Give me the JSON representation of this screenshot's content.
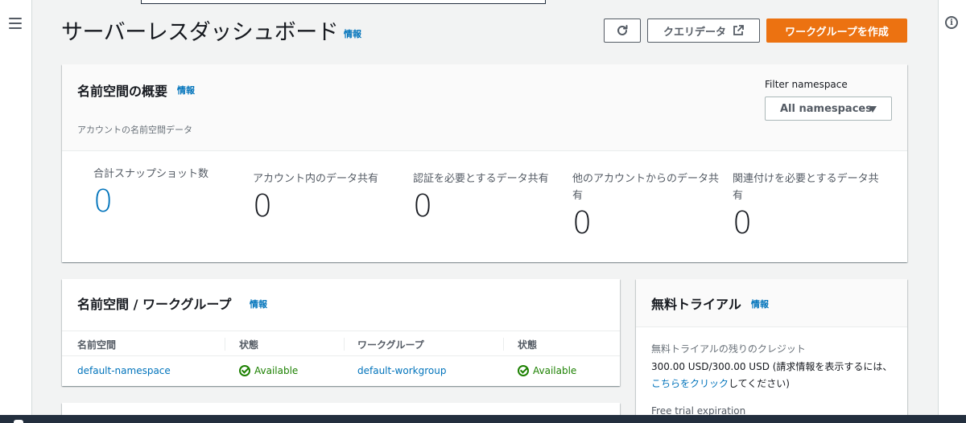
{
  "header": {
    "title": "サーバーレスダッシュボード",
    "info": "情報",
    "refresh_icon": "refresh-icon",
    "query_button": "クエリデータ",
    "query_icon": "external-link-icon",
    "create_button": "ワークグループを作成"
  },
  "overview": {
    "title": "名前空間の概要",
    "info": "情報",
    "description": "アカウントの名前空間データ",
    "filter_label": "Filter namespace",
    "filter_value": "All namespaces",
    "metrics": [
      {
        "label": "合計スナップショット数",
        "value": "0"
      },
      {
        "label": "アカウント内のデータ共有",
        "value": "0"
      },
      {
        "label": "認証を必要とするデータ共有",
        "value": "0"
      },
      {
        "label": "他のアカウントからのデータ共有",
        "value": "0"
      },
      {
        "label": "関連付けを必要とするデータ共有",
        "value": "0"
      }
    ]
  },
  "namespaces": {
    "title": "名前空間 / ワークグループ",
    "info": "情報",
    "columns": [
      "名前空間",
      "状態",
      "ワークグループ",
      "状態"
    ],
    "rows": [
      {
        "namespace": "default-namespace",
        "ns_status": "Available",
        "workgroup": "default-workgroup",
        "wg_status": "Available"
      }
    ]
  },
  "trial": {
    "title": "無料トライアル",
    "info": "情報",
    "credit_label": "無料トライアルの残りのクレジット",
    "credit_text": "300.00 USD/300.00 USD (請求情報を表示するには、",
    "credit_link": "こちらをクリック",
    "credit_suffix": "してください)",
    "expiration_label": "Free trial expiration"
  },
  "colors": {
    "accent": "#0073bb",
    "primary_button": "#ec7211",
    "success": "#1d8102",
    "background": "#f2f3f3"
  }
}
